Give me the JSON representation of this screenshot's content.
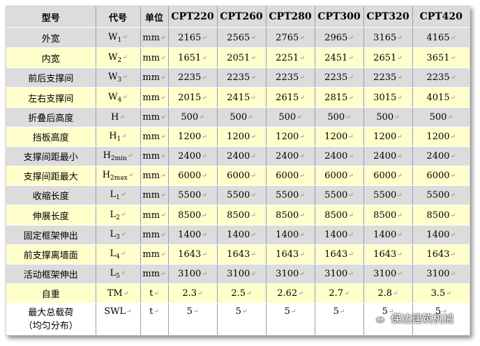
{
  "table": {
    "header": {
      "name": "型号",
      "code": "代号",
      "unit": "单位",
      "models": [
        "CPT220",
        "CPT260",
        "CPT280",
        "CPT300",
        "CPT320",
        "CPT420"
      ]
    },
    "rows": [
      {
        "name": "外宽",
        "code": "W",
        "sub": "1",
        "unit": "mm",
        "values": [
          "2165",
          "2565",
          "2765",
          "2965",
          "3165",
          "4165"
        ]
      },
      {
        "name": "内宽",
        "code": "W",
        "sub": "2",
        "unit": "mm",
        "values": [
          "1651",
          "2051",
          "2251",
          "2451",
          "2651",
          "3651"
        ]
      },
      {
        "name": "前后支撑间",
        "code": "W",
        "sub": "3",
        "unit": "mm",
        "values": [
          "2235",
          "2235",
          "2235",
          "2235",
          "2235",
          "2235"
        ]
      },
      {
        "name": "左右支撑间",
        "code": "W",
        "sub": "4",
        "unit": "mm",
        "values": [
          "2015",
          "2415",
          "2615",
          "2815",
          "3015",
          "4015"
        ]
      },
      {
        "name": "折叠后高度",
        "code": "H",
        "sub": "",
        "unit": "mm",
        "values": [
          "500",
          "500",
          "500",
          "500",
          "500",
          "500"
        ]
      },
      {
        "name": "挡板高度",
        "code": "H",
        "sub": "1",
        "unit": "mm",
        "values": [
          "1200",
          "1200",
          "1200",
          "1200",
          "1200",
          "1200"
        ]
      },
      {
        "name": "支撑间距最小",
        "code": "H",
        "sub": "2min",
        "unit": "mm",
        "values": [
          "2400",
          "2400",
          "2400",
          "2400",
          "2400",
          "2400"
        ]
      },
      {
        "name": "支撑间距最大",
        "code": "H",
        "sub": "2max",
        "unit": "mm",
        "values": [
          "6000",
          "6000",
          "6000",
          "6000",
          "6000",
          "6000"
        ]
      },
      {
        "name": "收缩长度",
        "code": "L",
        "sub": "1",
        "unit": "mm",
        "values": [
          "5500",
          "5500",
          "5500",
          "5500",
          "5500",
          "5500"
        ]
      },
      {
        "name": "伸展长度",
        "code": "L",
        "sub": "2",
        "unit": "mm",
        "values": [
          "8500",
          "8500",
          "8500",
          "8500",
          "8500",
          "8500"
        ]
      },
      {
        "name": "固定框架伸出",
        "code": "L",
        "sub": "3",
        "unit": "mm",
        "values": [
          "1400",
          "1400",
          "1400",
          "1400",
          "1400",
          "1400"
        ]
      },
      {
        "name": "前支撑离墙面",
        "code": "L",
        "sub": "4",
        "unit": "mm",
        "values": [
          "1643",
          "1643",
          "1643",
          "1643",
          "1643",
          "1643"
        ]
      },
      {
        "name": "活动框架伸出",
        "code": "L",
        "sub": "5",
        "unit": "mm",
        "values": [
          "3100",
          "3100",
          "3100",
          "3100",
          "3100",
          "3100"
        ]
      },
      {
        "name": "自重",
        "code": "TM",
        "sub": "",
        "unit": "t",
        "values": [
          "2.3",
          "2.5",
          "2.62",
          "2.7",
          "2.8",
          "3.5"
        ]
      },
      {
        "name": "最大总载荷",
        "name2": "（均匀分布）",
        "code": "SWL",
        "sub": "",
        "unit": "t",
        "values": [
          "5",
          "5",
          "5",
          "5",
          "5",
          "5"
        ]
      }
    ]
  },
  "watermark": {
    "text": "保达建筑机械",
    "icon": "wechat-icon"
  },
  "colors": {
    "header": "#dcdcdc",
    "gray": "#dcdcdc",
    "yellow": "#ffffcc",
    "white": "#ffffff",
    "separator": "#8aa0c8"
  }
}
